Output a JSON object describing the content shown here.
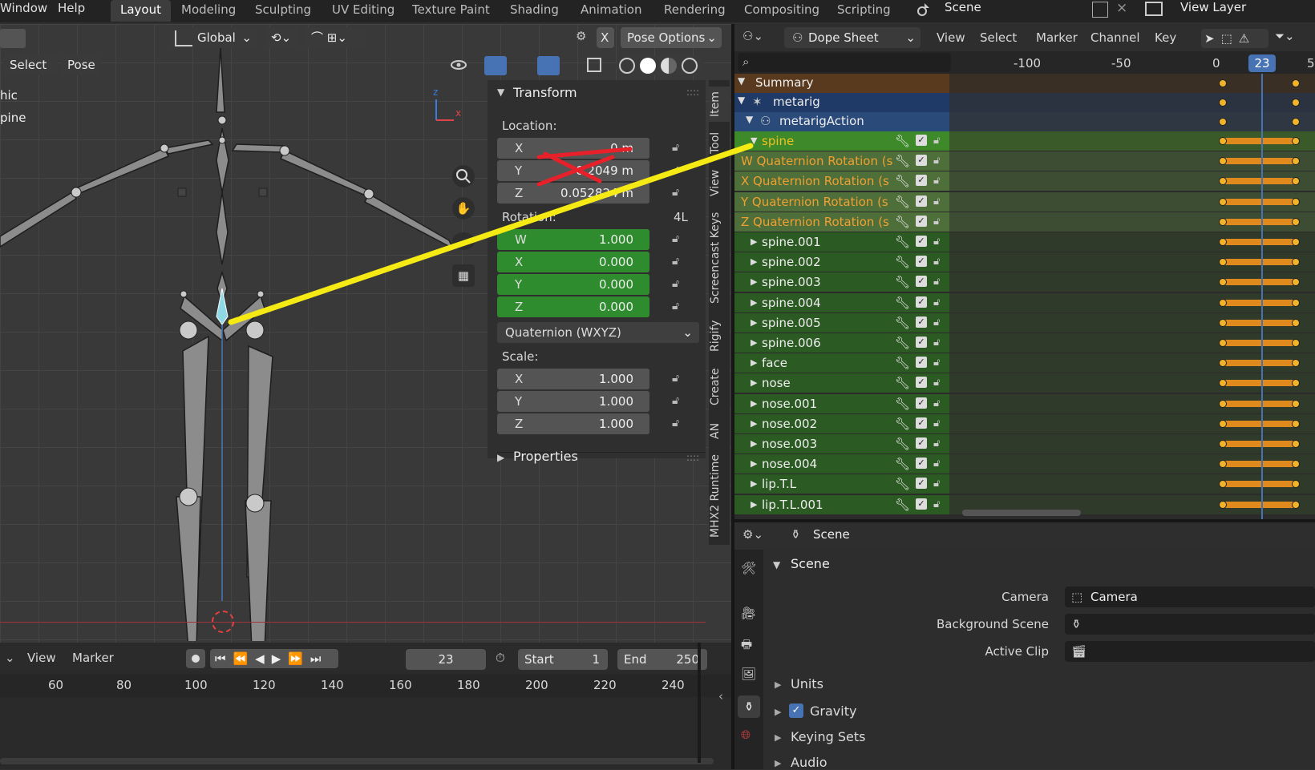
{
  "topbar": {
    "menus": [
      "Window",
      "Help"
    ],
    "workspaces": [
      "Layout",
      "Modeling",
      "Sculpting",
      "UV Editing",
      "Texture Paint",
      "Shading",
      "Animation",
      "Rendering",
      "Compositing",
      "Scripting"
    ],
    "active_workspace": "Layout",
    "scene_label": "Scene",
    "view_layer_label": "View Layer"
  },
  "viewport": {
    "orientation": "Global",
    "pose_options": "Pose Options",
    "x_label": "X",
    "select": "Select",
    "pose": "Pose",
    "overlay_partial_1": "hic",
    "overlay_partial_2": "pine",
    "gizmo_z": "z",
    "gizmo_x": "x"
  },
  "npanel": {
    "transform_title": "Transform",
    "location_label": "Location:",
    "location": [
      {
        "axis": "X",
        "value": "0 m"
      },
      {
        "axis": "Y",
        "value": "0.2049 m"
      },
      {
        "axis": "Z",
        "value": "0.052824 m"
      }
    ],
    "rotation_label": "Rotation:",
    "rotation_mode_short": "4L",
    "rotation": [
      {
        "axis": "W",
        "value": "1.000"
      },
      {
        "axis": "X",
        "value": "0.000"
      },
      {
        "axis": "Y",
        "value": "0.000"
      },
      {
        "axis": "Z",
        "value": "0.000"
      }
    ],
    "rotation_mode": "Quaternion (WXYZ)",
    "scale_label": "Scale:",
    "scale": [
      {
        "axis": "X",
        "value": "1.000"
      },
      {
        "axis": "Y",
        "value": "1.000"
      },
      {
        "axis": "Z",
        "value": "1.000"
      }
    ],
    "properties_title": "Properties",
    "tabs": [
      "Item",
      "Tool",
      "View",
      "Screencast Keys",
      "Rigify",
      "Create",
      "AN",
      "MHX2 Runtime"
    ]
  },
  "dopesheet": {
    "mode": "Dope Sheet",
    "menus": [
      "View",
      "Select",
      "Marker",
      "Channel",
      "Key"
    ],
    "ruler": [
      "-100",
      "-50",
      "0"
    ],
    "current_frame": "23",
    "ruler_partial": "5",
    "summary": "Summary",
    "object": "metarig",
    "action": "metarigAction",
    "channels": [
      {
        "name": "spine",
        "type": "group"
      },
      {
        "name": "W Quaternion Rotation (s",
        "type": "fcurve"
      },
      {
        "name": "X Quaternion Rotation (s",
        "type": "fcurve"
      },
      {
        "name": "Y Quaternion Rotation (s",
        "type": "fcurve"
      },
      {
        "name": "Z Quaternion Rotation (s",
        "type": "fcurve"
      },
      {
        "name": "spine.001",
        "type": "group"
      },
      {
        "name": "spine.002",
        "type": "group"
      },
      {
        "name": "spine.003",
        "type": "group"
      },
      {
        "name": "spine.004",
        "type": "group"
      },
      {
        "name": "spine.005",
        "type": "group"
      },
      {
        "name": "spine.006",
        "type": "group"
      },
      {
        "name": "face",
        "type": "group"
      },
      {
        "name": "nose",
        "type": "group"
      },
      {
        "name": "nose.001",
        "type": "group"
      },
      {
        "name": "nose.002",
        "type": "group"
      },
      {
        "name": "nose.003",
        "type": "group"
      },
      {
        "name": "nose.004",
        "type": "group"
      },
      {
        "name": "lip.T.L",
        "type": "group"
      },
      {
        "name": "lip.T.L.001",
        "type": "group"
      }
    ]
  },
  "timeline": {
    "menus": [
      "View",
      "Marker"
    ],
    "current_frame": "23",
    "start_label": "Start",
    "start": "1",
    "end_label": "End",
    "end": "250",
    "ruler": [
      "60",
      "80",
      "100",
      "120",
      "140",
      "160",
      "180",
      "200",
      "220",
      "240"
    ]
  },
  "properties": {
    "context": "Scene",
    "panel_title": "Scene",
    "camera_label": "Camera",
    "camera_value": "Camera",
    "background_scene_label": "Background Scene",
    "active_clip_label": "Active Clip",
    "subpanels": [
      "Units",
      "Gravity",
      "Keying Sets",
      "Audio"
    ],
    "gravity_checked": true
  },
  "colors": {
    "accent_blue": "#4772b3",
    "keyframe_orange": "#e0891d",
    "channel_green": "#2e6b2e",
    "annotation_yellow": "#f5ea14",
    "annotation_red": "#e8202a"
  }
}
